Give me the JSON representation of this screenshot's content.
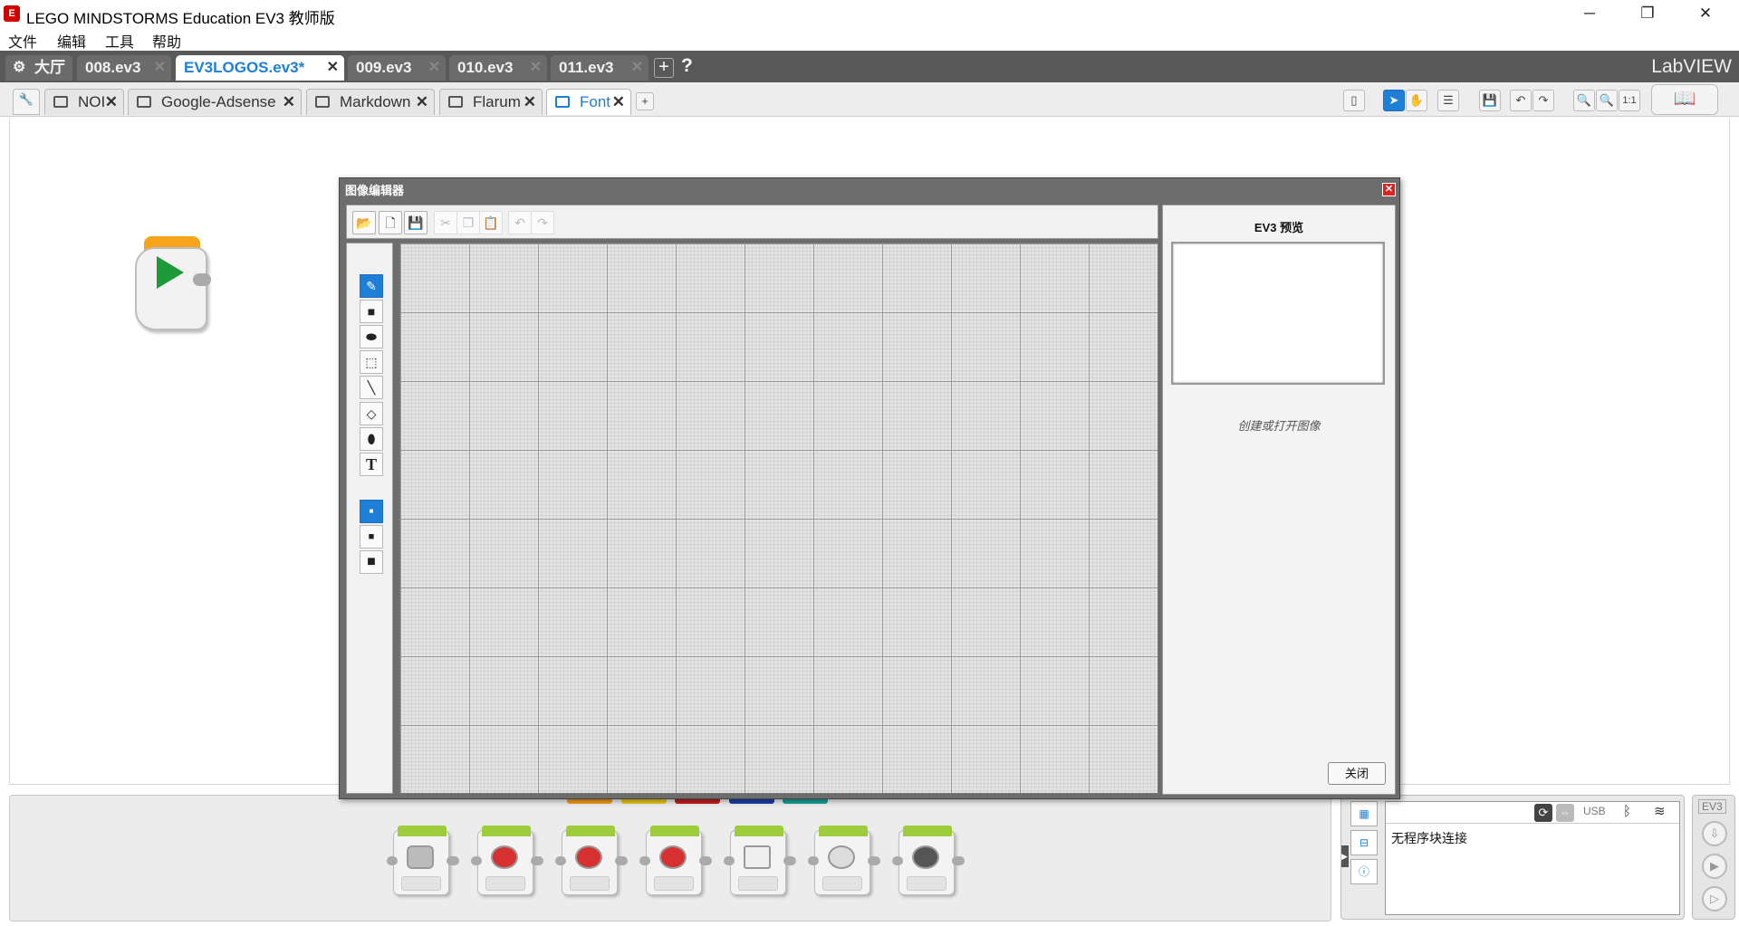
{
  "window": {
    "title": "LEGO MINDSTORMS Education EV3 教师版",
    "app_icon": "lego-app-icon"
  },
  "menu": [
    "文件",
    "编辑",
    "工具",
    "帮助"
  ],
  "project_tabs": {
    "lobby": "大厅",
    "tabs": [
      "008.ev3",
      "EV3LOGOS.ev3*",
      "009.ev3",
      "010.ev3",
      "011.ev3"
    ],
    "active": "EV3LOGOS.ev3*",
    "help": "?",
    "brand": "LabVIEW"
  },
  "program_tabs": {
    "tabs": [
      "NOI",
      "Google-Adsense",
      "Markdown",
      "Flarum",
      "Font"
    ],
    "active": "Font",
    "add": "+"
  },
  "toolbar_right": {
    "zoom_reset": "1:1"
  },
  "dialog": {
    "title": "图像编辑器",
    "close": "✕",
    "preview_title": "EV3 预览",
    "hint": "创建或打开图像",
    "close_button": "关闭"
  },
  "hardware": {
    "usb": "USB",
    "status": "无程序块连接",
    "ev3_label": "EV3"
  },
  "colors": {
    "accent": "#1e7fd6",
    "start_orange": "#f7a31c",
    "play_green": "#1e9a3a",
    "palette_green": "#9dcc3c",
    "palette_strip": [
      "#f29a1e",
      "#e8c51b",
      "#c0201f",
      "#1d3fa6",
      "#17a39a"
    ]
  }
}
